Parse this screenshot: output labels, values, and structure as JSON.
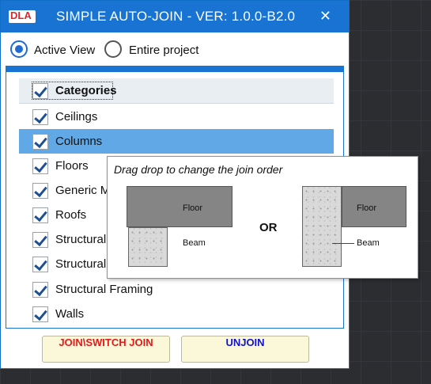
{
  "window": {
    "logo_text": "DLA",
    "title": "SIMPLE AUTO-JOIN - VER: 1.0.0-B2.0",
    "close_glyph": "✕"
  },
  "scope": {
    "options": [
      {
        "label": "Active View",
        "selected": true
      },
      {
        "label": "Entire project",
        "selected": false
      }
    ]
  },
  "categories": {
    "header": "Categories",
    "items": [
      {
        "label": "Ceilings",
        "checked": true,
        "selected": false
      },
      {
        "label": "Columns",
        "checked": true,
        "selected": true
      },
      {
        "label": "Floors",
        "checked": true,
        "selected": false
      },
      {
        "label": "Generic M",
        "checked": true,
        "selected": false
      },
      {
        "label": "Roofs",
        "checked": true,
        "selected": false
      },
      {
        "label": "Structural",
        "checked": true,
        "selected": false
      },
      {
        "label": "Structural",
        "checked": true,
        "selected": false
      },
      {
        "label": "Structural Framing",
        "checked": true,
        "selected": false
      },
      {
        "label": "Walls",
        "checked": true,
        "selected": false
      }
    ]
  },
  "buttons": {
    "join_label": "JOIN\\SWITCH JOIN",
    "unjoin_label": "UNJOIN"
  },
  "tooltip": {
    "text": "Drag drop to change the join order",
    "or": "OR",
    "left_floor": "Floor",
    "left_beam": "Beam",
    "right_floor": "Floor",
    "right_beam": "Beam"
  },
  "colors": {
    "accent": "#1873d3",
    "selection": "#61a8e6",
    "join_text": "#e01a1a",
    "unjoin_text": "#1212c8",
    "button_bg": "#fbf8d9"
  }
}
